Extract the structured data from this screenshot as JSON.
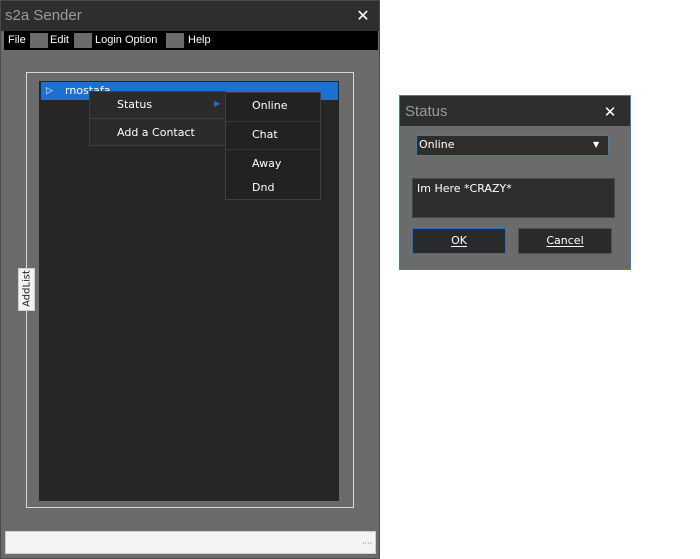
{
  "main_window": {
    "title": "s2a Sender",
    "close_icon": "close-icon",
    "menu": [
      "File",
      "Edit",
      "Login Option",
      "Help"
    ],
    "tree": {
      "expander_icon": "triangle-right-icon",
      "user": "rnostafa"
    },
    "side_tab": "AddList",
    "resize_grip_icon": "resize-grip-icon"
  },
  "context_menu": {
    "items": [
      "Status",
      "Add a Contact"
    ],
    "submenu_arrow_icon": "chevron-right-icon",
    "status_submenu": [
      "Online",
      "Chat",
      "Away",
      "Dnd"
    ]
  },
  "status_dialog": {
    "title": "Status",
    "close_icon": "close-icon",
    "selected_status": "Online",
    "dropdown_icon": "chevron-down-icon",
    "message": "Im Here *CRAZY*",
    "ok_label": "OK",
    "cancel_label": "Cancel"
  },
  "colors": {
    "window_bg": "#6b6b6b",
    "titlebar_bg": "#2e2e2e",
    "panel_bg": "#262626",
    "selection": "#1f6fd1",
    "accent_border": "#3b7ec0"
  }
}
